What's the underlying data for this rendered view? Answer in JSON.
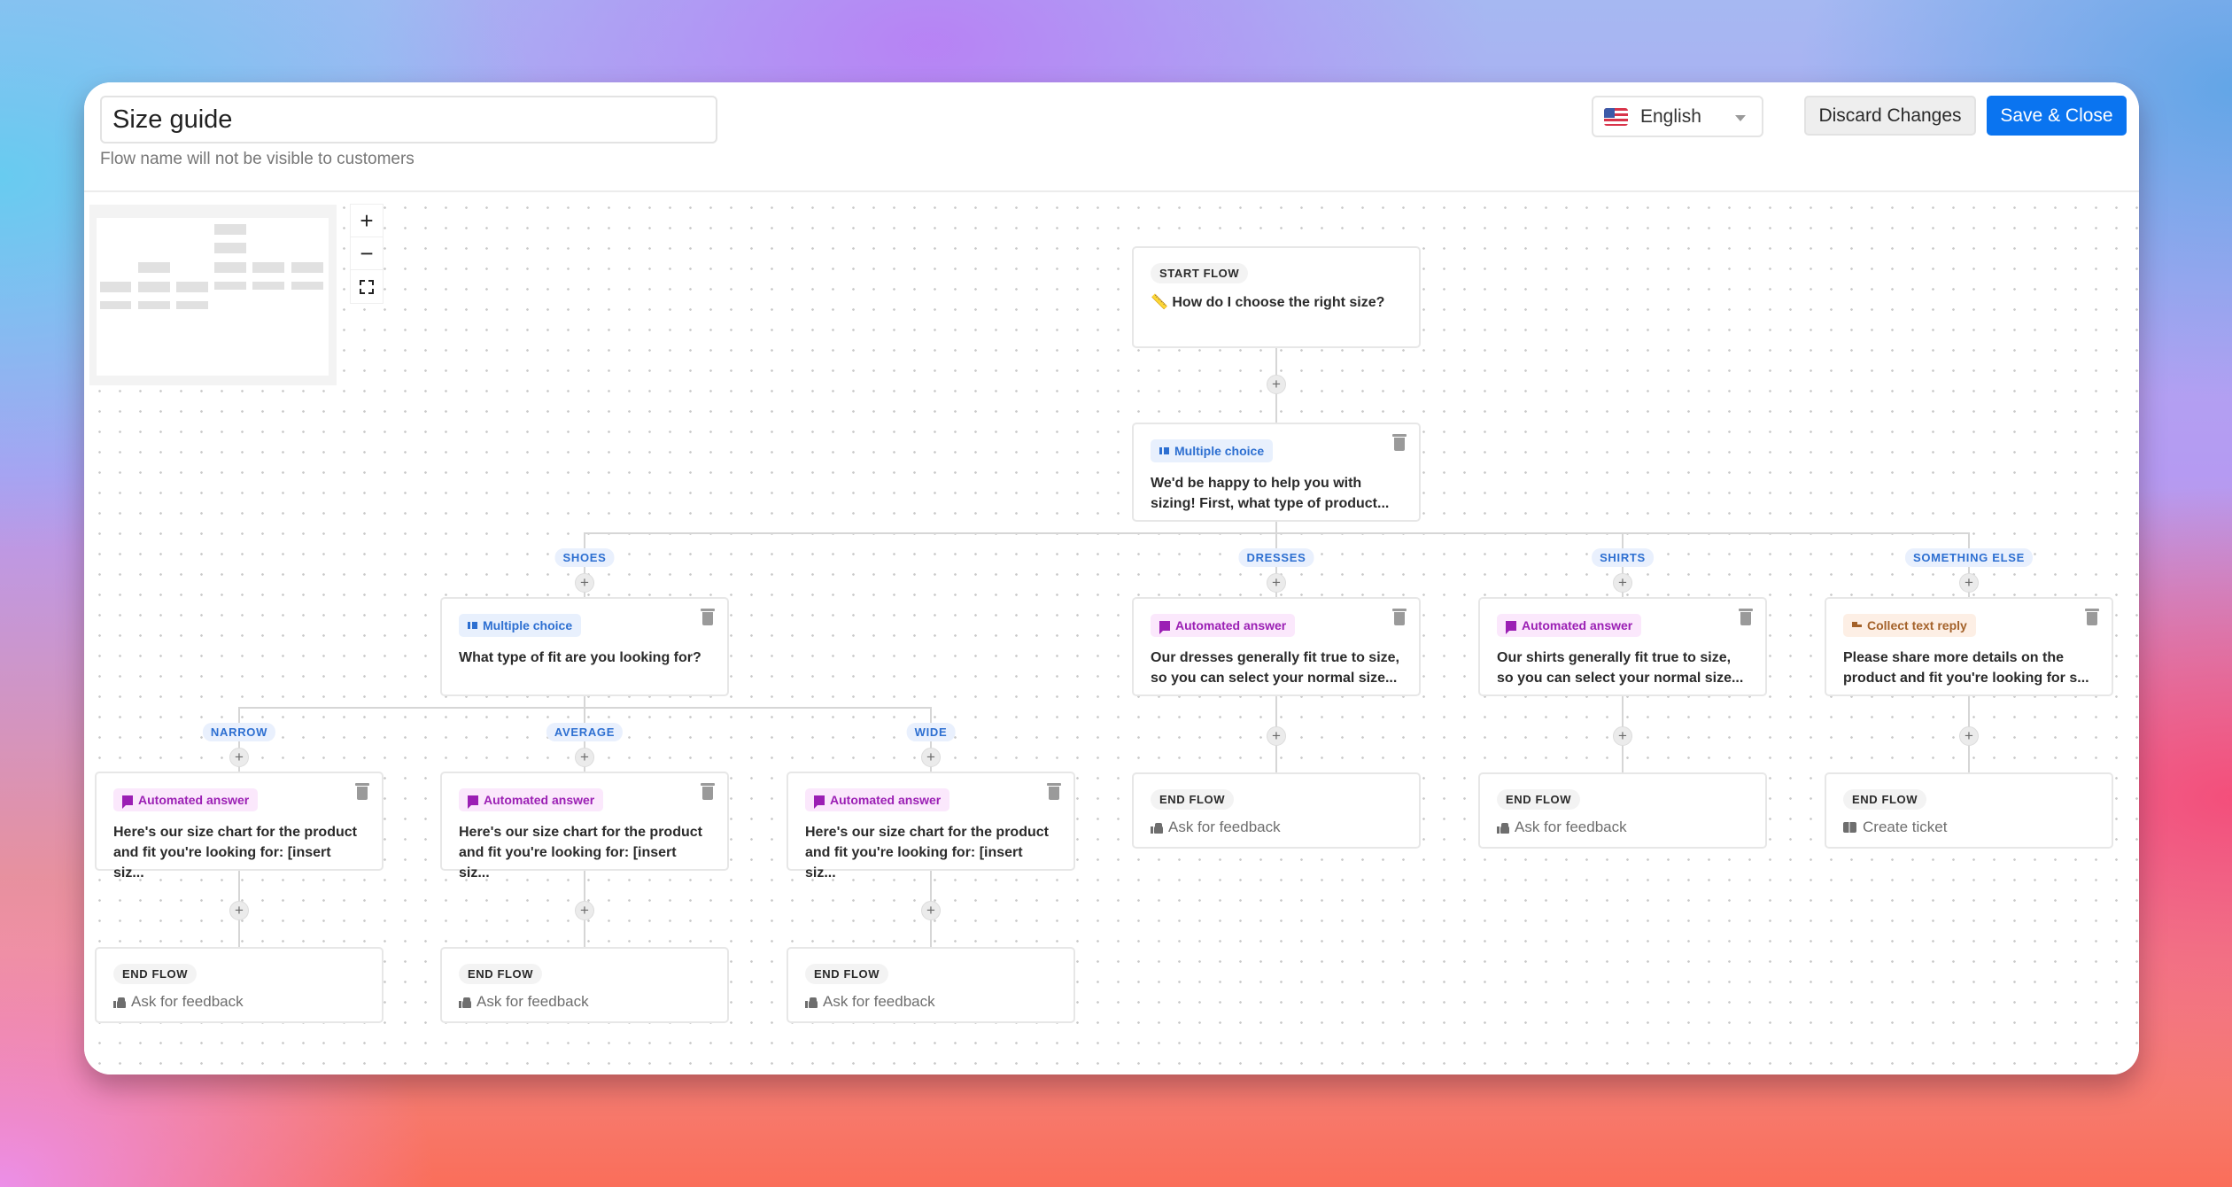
{
  "header": {
    "flow_name": "Size guide",
    "flow_name_hint": "Flow name will not be visible to customers",
    "language": {
      "flag_icon": "us-flag-icon",
      "selected": "English"
    },
    "discard_label": "Discard Changes",
    "save_label": "Save & Close"
  },
  "colors": {
    "primary": "#0a74f0",
    "multiple_choice": "#2d6fd1",
    "automated_answer": "#9b1fb4",
    "collect_text": "#a4622a"
  },
  "canvas": {
    "zoom_controls": {
      "zoom_in": "+",
      "zoom_out": "−",
      "fit_view": "fit-view-icon"
    },
    "start_node": {
      "chip": "START FLOW",
      "icon": "ruler-icon",
      "icon_glyph": "📏",
      "title": "How do I choose the right size?"
    },
    "root_question": {
      "type": "Multiple choice",
      "text": "We'd be happy to help you with sizing! First, what type of product..."
    },
    "branches": [
      {
        "label": "SHOES",
        "node": {
          "type": "Multiple choice",
          "text": "What type of fit are you looking for?"
        },
        "sub_branches": [
          {
            "label": "NARROW",
            "node": {
              "type": "Automated answer",
              "text": "Here's our size chart for the product and fit you're looking for: [insert siz..."
            },
            "end": {
              "chip": "END FLOW",
              "action": "Ask for feedback"
            }
          },
          {
            "label": "AVERAGE",
            "node": {
              "type": "Automated answer",
              "text": "Here's our size chart for the product and fit you're looking for: [insert siz..."
            },
            "end": {
              "chip": "END FLOW",
              "action": "Ask for feedback"
            }
          },
          {
            "label": "WIDE",
            "node": {
              "type": "Automated answer",
              "text": "Here's our size chart for the product and fit you're looking for: [insert siz..."
            },
            "end": {
              "chip": "END FLOW",
              "action": "Ask for feedback"
            }
          }
        ]
      },
      {
        "label": "DRESSES",
        "node": {
          "type": "Automated answer",
          "text": "Our dresses generally fit true to size, so you can select your normal size..."
        },
        "end": {
          "chip": "END FLOW",
          "action": "Ask for feedback"
        }
      },
      {
        "label": "SHIRTS",
        "node": {
          "type": "Automated answer",
          "text": "Our shirts generally fit true to size, so you can select your normal size..."
        },
        "end": {
          "chip": "END FLOW",
          "action": "Ask for feedback"
        }
      },
      {
        "label": "SOMETHING ELSE",
        "node": {
          "type": "Collect text reply",
          "text": "Please share more details on the product and fit you're looking for s..."
        },
        "end": {
          "chip": "END FLOW",
          "action": "Create ticket"
        }
      }
    ]
  }
}
